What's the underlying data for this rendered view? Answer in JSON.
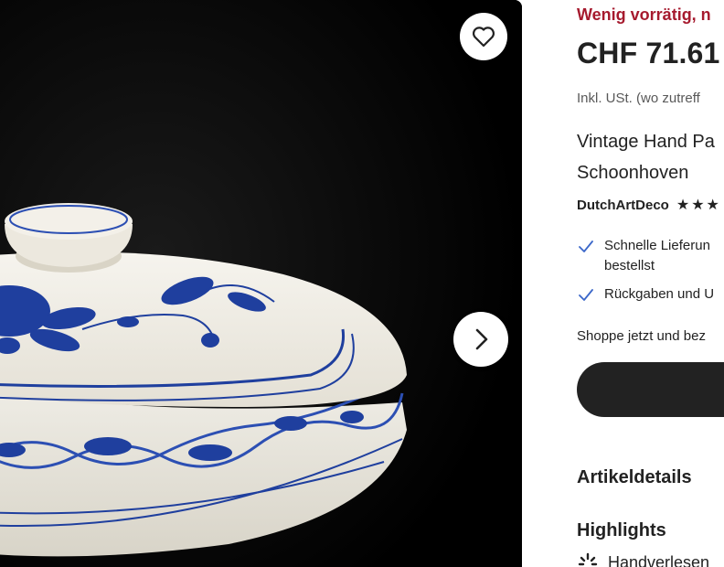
{
  "image_panel": {
    "favorite_icon": "heart-outline-icon",
    "next_icon": "chevron-right-icon"
  },
  "product": {
    "stock_status": "Wenig vorrätig, n",
    "price": "CHF 71.61",
    "tax_note": "Inkl. USt. (wo zutreff",
    "title_line1": "Vintage Hand Pa",
    "title_line2": "Schoonhoven",
    "shop_name": "DutchArtDeco",
    "stars": [
      "★",
      "★",
      "★"
    ]
  },
  "benefits": [
    {
      "icon": "check-icon",
      "line1": "Schnelle Lieferun",
      "line2": "bestellst"
    },
    {
      "icon": "check-icon",
      "line1": "Rückgaben und U"
    }
  ],
  "shop_now_text": "Shoppe jetzt und bez",
  "sections": {
    "artikeldetails": "Artikeldetails",
    "highlights": "Highlights",
    "handpicked_label": "Handverlesen",
    "handpicked_icon": "sparkle-icon"
  },
  "colors": {
    "stock_red": "#a61a2e",
    "delft_blue": "#1f3f9e",
    "check_blue": "#3b67c9",
    "button_dark": "#222222"
  }
}
